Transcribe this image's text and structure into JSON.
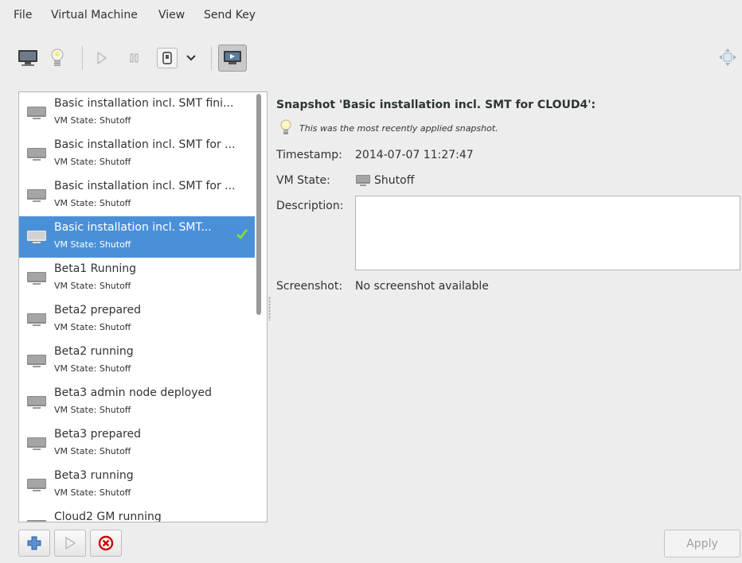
{
  "menu": {
    "file": "File",
    "virtual_machine": "Virtual Machine",
    "view": "View",
    "send_key": "Send Key"
  },
  "toolbar": {
    "icons": [
      "console-icon",
      "details-lightbulb-icon",
      "run-icon",
      "pause-icon",
      "shutdown-icon",
      "shutdown-dropdown-icon",
      "snapshots-icon",
      "resize-icon"
    ]
  },
  "snapshots": [
    {
      "name": "Basic installation incl. SMT fini...",
      "state": "VM State: Shutoff"
    },
    {
      "name": "Basic installation incl. SMT for ...",
      "state": "VM State: Shutoff"
    },
    {
      "name": "Basic installation incl. SMT for ...",
      "state": "VM State: Shutoff"
    },
    {
      "name": "Basic installation incl. SMT...",
      "state": "VM State: Shutoff"
    },
    {
      "name": "Beta1 Running",
      "state": "VM State: Shutoff"
    },
    {
      "name": "Beta2 prepared",
      "state": "VM State: Shutoff"
    },
    {
      "name": "Beta2 running",
      "state": "VM State: Shutoff"
    },
    {
      "name": "Beta3 admin node deployed",
      "state": "VM State: Shutoff"
    },
    {
      "name": "Beta3 prepared",
      "state": "VM State: Shutoff"
    },
    {
      "name": "Beta3 running",
      "state": "VM State: Shutoff"
    },
    {
      "name": "Cloud2 GM running",
      "state": ""
    }
  ],
  "selected_index": 3,
  "details": {
    "title": "Snapshot 'Basic installation incl. SMT for CLOUD4':",
    "note": "This was the most recently applied snapshot.",
    "timestamp_label": "Timestamp:",
    "timestamp_value": "2014-07-07 11:27:47",
    "vm_state_label": "VM State:",
    "vm_state_value": "Shutoff",
    "description_label": "Description:",
    "description_value": "",
    "screenshot_label": "Screenshot:",
    "screenshot_value": "No screenshot available"
  },
  "buttons": {
    "apply": "Apply",
    "add_icon": "add-snapshot-icon",
    "run_icon": "run-snapshot-icon",
    "delete_icon": "delete-snapshot-icon"
  },
  "colors": {
    "selection": "#4a90d9",
    "check": "#8ae234",
    "delete": "#cc0000",
    "add": "#3465a4"
  }
}
